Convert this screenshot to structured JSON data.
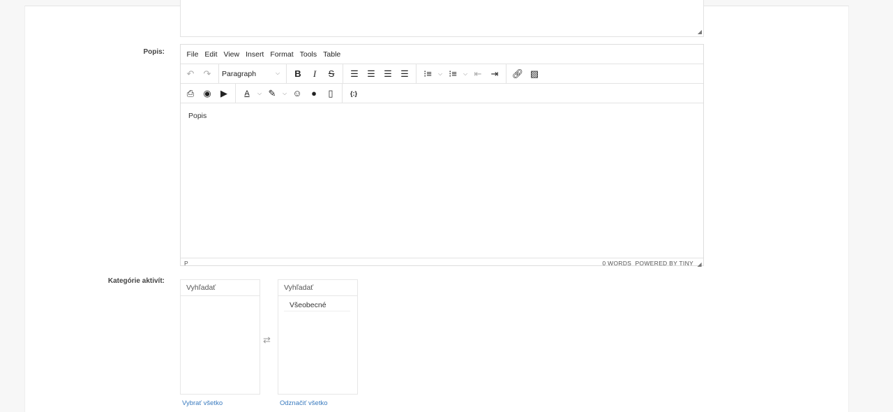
{
  "form": {
    "popis_label": "Popis:",
    "kategorie_label": "Kategórie aktivít:"
  },
  "editor": {
    "menu": [
      "File",
      "Edit",
      "View",
      "Insert",
      "Format",
      "Tools",
      "Table"
    ],
    "block_format": "Paragraph",
    "content": "Popis",
    "status_path": "P",
    "word_count": "0 WORDS",
    "powered_by": "POWERED BY TINY"
  },
  "dual_list": {
    "left": {
      "search_placeholder": "Vyhľadať",
      "items": [],
      "link": "Vybrať všetko"
    },
    "right": {
      "search_placeholder": "Vyhľadať",
      "items": [
        "Všeobecné"
      ],
      "link": "Odznačiť všetko"
    }
  }
}
